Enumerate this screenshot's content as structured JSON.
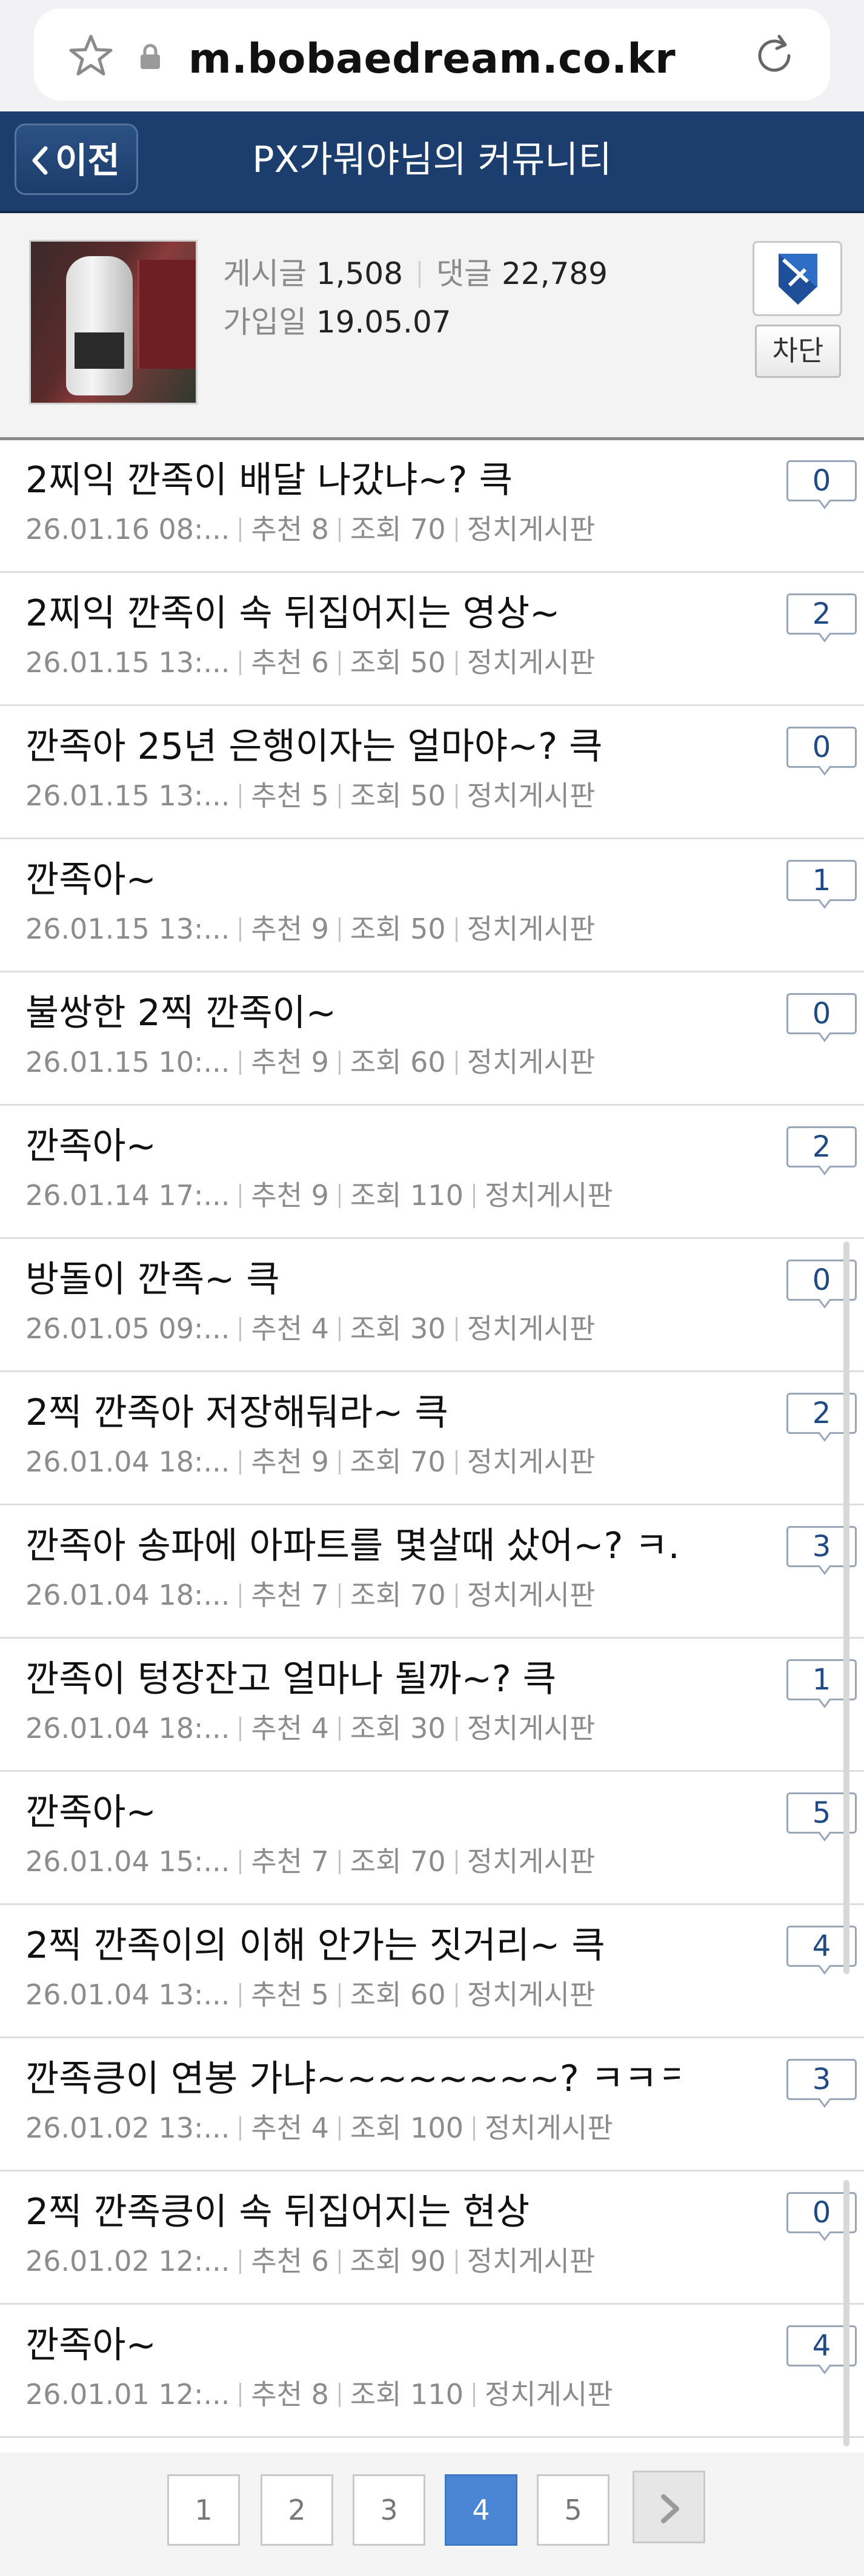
{
  "browser": {
    "url": "m.bobaedream.co.kr"
  },
  "header": {
    "back_label": "이전",
    "title": "PX가뭐야님의 커뮤니티"
  },
  "profile": {
    "posts_label": "게시글",
    "posts_count": "1,508",
    "comments_label": "댓글",
    "comments_count": "22,789",
    "joined_label": "가입일",
    "joined_date": "19.05.07",
    "block_label": "차단"
  },
  "posts": [
    {
      "title": "2찌익 깐족이 배달 나갔냐~? 큭",
      "date": "26.01.16  08:...",
      "recommend": "추천 8",
      "views": "조회 70",
      "board": "정치게시판",
      "comments": "0"
    },
    {
      "title": "2찌익 깐족이 속 뒤집어지는 영상~",
      "date": "26.01.15  13:...",
      "recommend": "추천 6",
      "views": "조회 50",
      "board": "정치게시판",
      "comments": "2"
    },
    {
      "title": "깐족아 25년 은행이자는 얼마야~? 큭",
      "date": "26.01.15  13:...",
      "recommend": "추천 5",
      "views": "조회 50",
      "board": "정치게시판",
      "comments": "0"
    },
    {
      "title": "깐족아~",
      "date": "26.01.15  13:...",
      "recommend": "추천 9",
      "views": "조회 50",
      "board": "정치게시판",
      "comments": "1"
    },
    {
      "title": "불쌍한 2찍 깐족이~",
      "date": "26.01.15  10:...",
      "recommend": "추천 9",
      "views": "조회 60",
      "board": "정치게시판",
      "comments": "0"
    },
    {
      "title": "깐족아~",
      "date": "26.01.14  17:...",
      "recommend": "추천 9",
      "views": "조회 110",
      "board": "정치게시판",
      "comments": "2"
    },
    {
      "title": "방돌이 깐족~ 큭",
      "date": "26.01.05  09:...",
      "recommend": "추천 4",
      "views": "조회 30",
      "board": "정치게시판",
      "comments": "0"
    },
    {
      "title": "2찍 깐족아 저장해둬라~ 큭",
      "date": "26.01.04  18:...",
      "recommend": "추천 9",
      "views": "조회 70",
      "board": "정치게시판",
      "comments": "2"
    },
    {
      "title": "깐족아 송파에 아파트를 몇살때 샀어~? ㅋ...",
      "date": "26.01.04  18:...",
      "recommend": "추천 7",
      "views": "조회 70",
      "board": "정치게시판",
      "comments": "3"
    },
    {
      "title": "깐족이 텅장잔고 얼마나 될까~? 큭",
      "date": "26.01.04  18:...",
      "recommend": "추천 4",
      "views": "조회 30",
      "board": "정치게시판",
      "comments": "1"
    },
    {
      "title": "깐족아~",
      "date": "26.01.04  15:...",
      "recommend": "추천 7",
      "views": "조회 70",
      "board": "정치게시판",
      "comments": "5"
    },
    {
      "title": "2찍 깐족이의 이해 안가는 짓거리~ 큭",
      "date": "26.01.04  13:...",
      "recommend": "추천 5",
      "views": "조회 60",
      "board": "정치게시판",
      "comments": "4"
    },
    {
      "title": "깐족킁이 연봉 가냐~~~~~~~~? ㅋㅋㅋ...",
      "date": "26.01.02  13:...",
      "recommend": "추천 4",
      "views": "조회 100",
      "board": "정치게시판",
      "comments": "3"
    },
    {
      "title": "2찍 깐족킁이 속 뒤집어지는 현상",
      "date": "26.01.02  12:...",
      "recommend": "추천 6",
      "views": "조회 90",
      "board": "정치게시판",
      "comments": "0"
    },
    {
      "title": "깐족아~",
      "date": "26.01.01  12:...",
      "recommend": "추천 8",
      "views": "조회 110",
      "board": "정치게시판",
      "comments": "4"
    }
  ],
  "pagination": {
    "pages": [
      "1",
      "2",
      "3",
      "4",
      "5"
    ],
    "current": "4"
  },
  "colors": {
    "header_bg": "#1c3e6e",
    "active_page": "#4a86d4",
    "comment_count_text": "#1f4a86"
  }
}
